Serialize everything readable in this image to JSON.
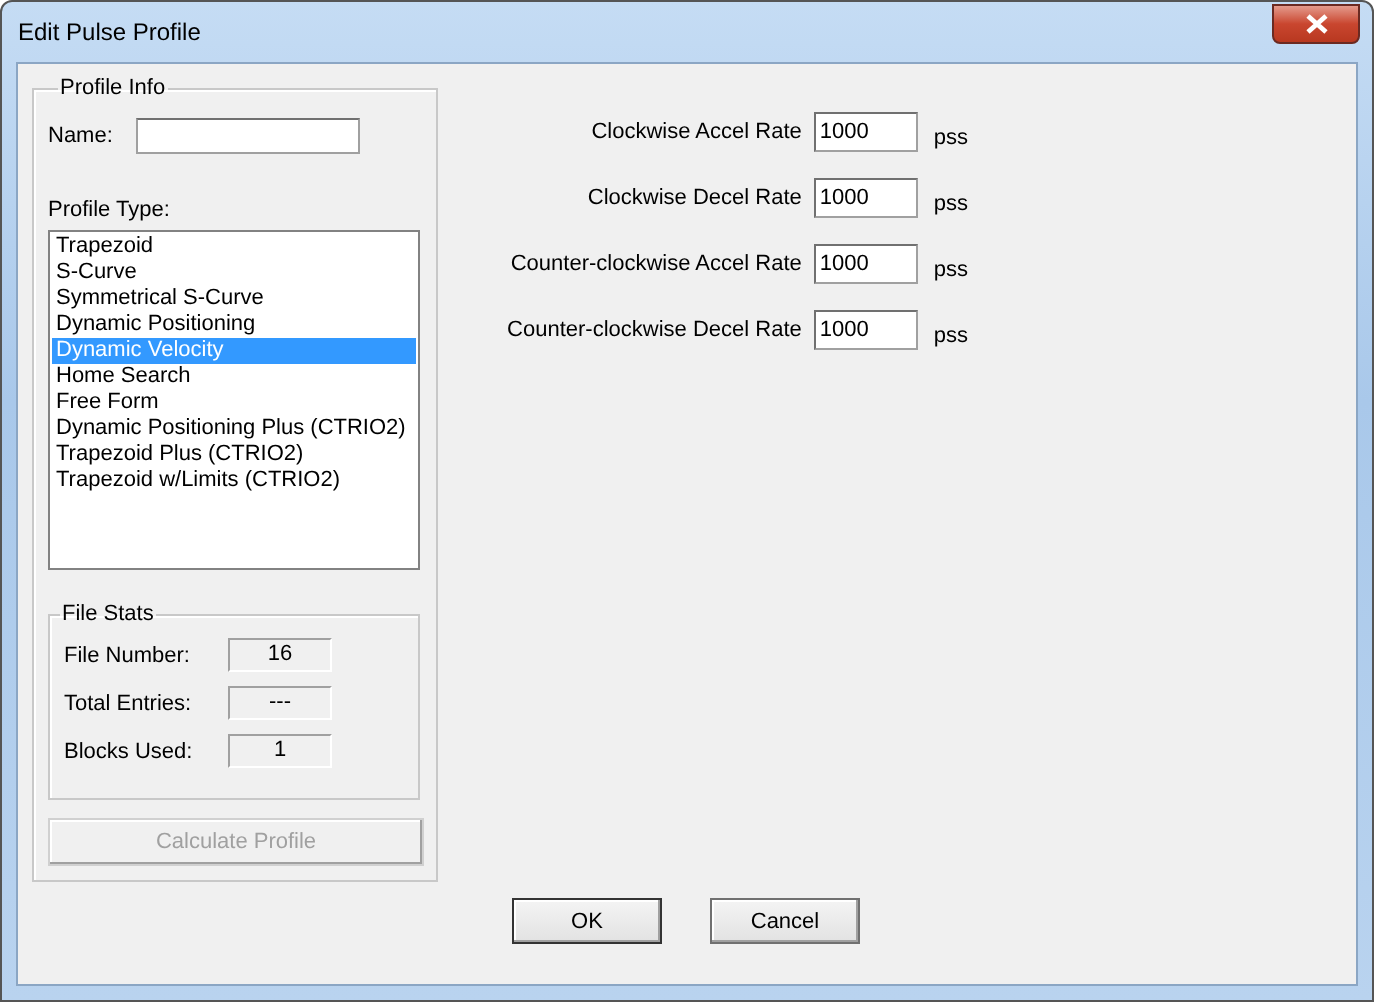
{
  "window": {
    "title": "Edit Pulse Profile"
  },
  "profile_info": {
    "title": "Profile Info",
    "name_label": "Name:",
    "type_label": "Profile Type:",
    "types": [
      {
        "label": "Trapezoid",
        "selected": false
      },
      {
        "label": "S-Curve",
        "selected": false
      },
      {
        "label": "Symmetrical S-Curve",
        "selected": false
      },
      {
        "label": "Dynamic Positioning",
        "selected": false
      },
      {
        "label": "Dynamic Velocity",
        "selected": true
      },
      {
        "label": "Home Search",
        "selected": false
      },
      {
        "label": "Free Form",
        "selected": false
      },
      {
        "label": "Dynamic Positioning Plus (CTRIO2)",
        "selected": false
      },
      {
        "label": "Trapezoid Plus (CTRIO2)",
        "selected": false
      },
      {
        "label": "Trapezoid w/Limits (CTRIO2)",
        "selected": false
      }
    ]
  },
  "file_stats": {
    "title": "File Stats",
    "rows": [
      {
        "label": "File Number:",
        "value": "16"
      },
      {
        "label": "Total Entries:",
        "value": "---"
      },
      {
        "label": "Blocks Used:",
        "value": "1"
      }
    ]
  },
  "calculate_button": {
    "label": "Calculate Profile",
    "disabled": true
  },
  "rates": [
    {
      "label": "Clockwise Accel Rate",
      "value": "1000",
      "unit": "pss"
    },
    {
      "label": "Clockwise Decel Rate",
      "value": "1000",
      "unit": "pss"
    },
    {
      "label": "Counter-clockwise Accel Rate",
      "value": "1000",
      "unit": "pss"
    },
    {
      "label": "Counter-clockwise Decel Rate",
      "value": "1000",
      "unit": "pss"
    }
  ],
  "buttons": [
    "OK",
    "Cancel"
  ]
}
